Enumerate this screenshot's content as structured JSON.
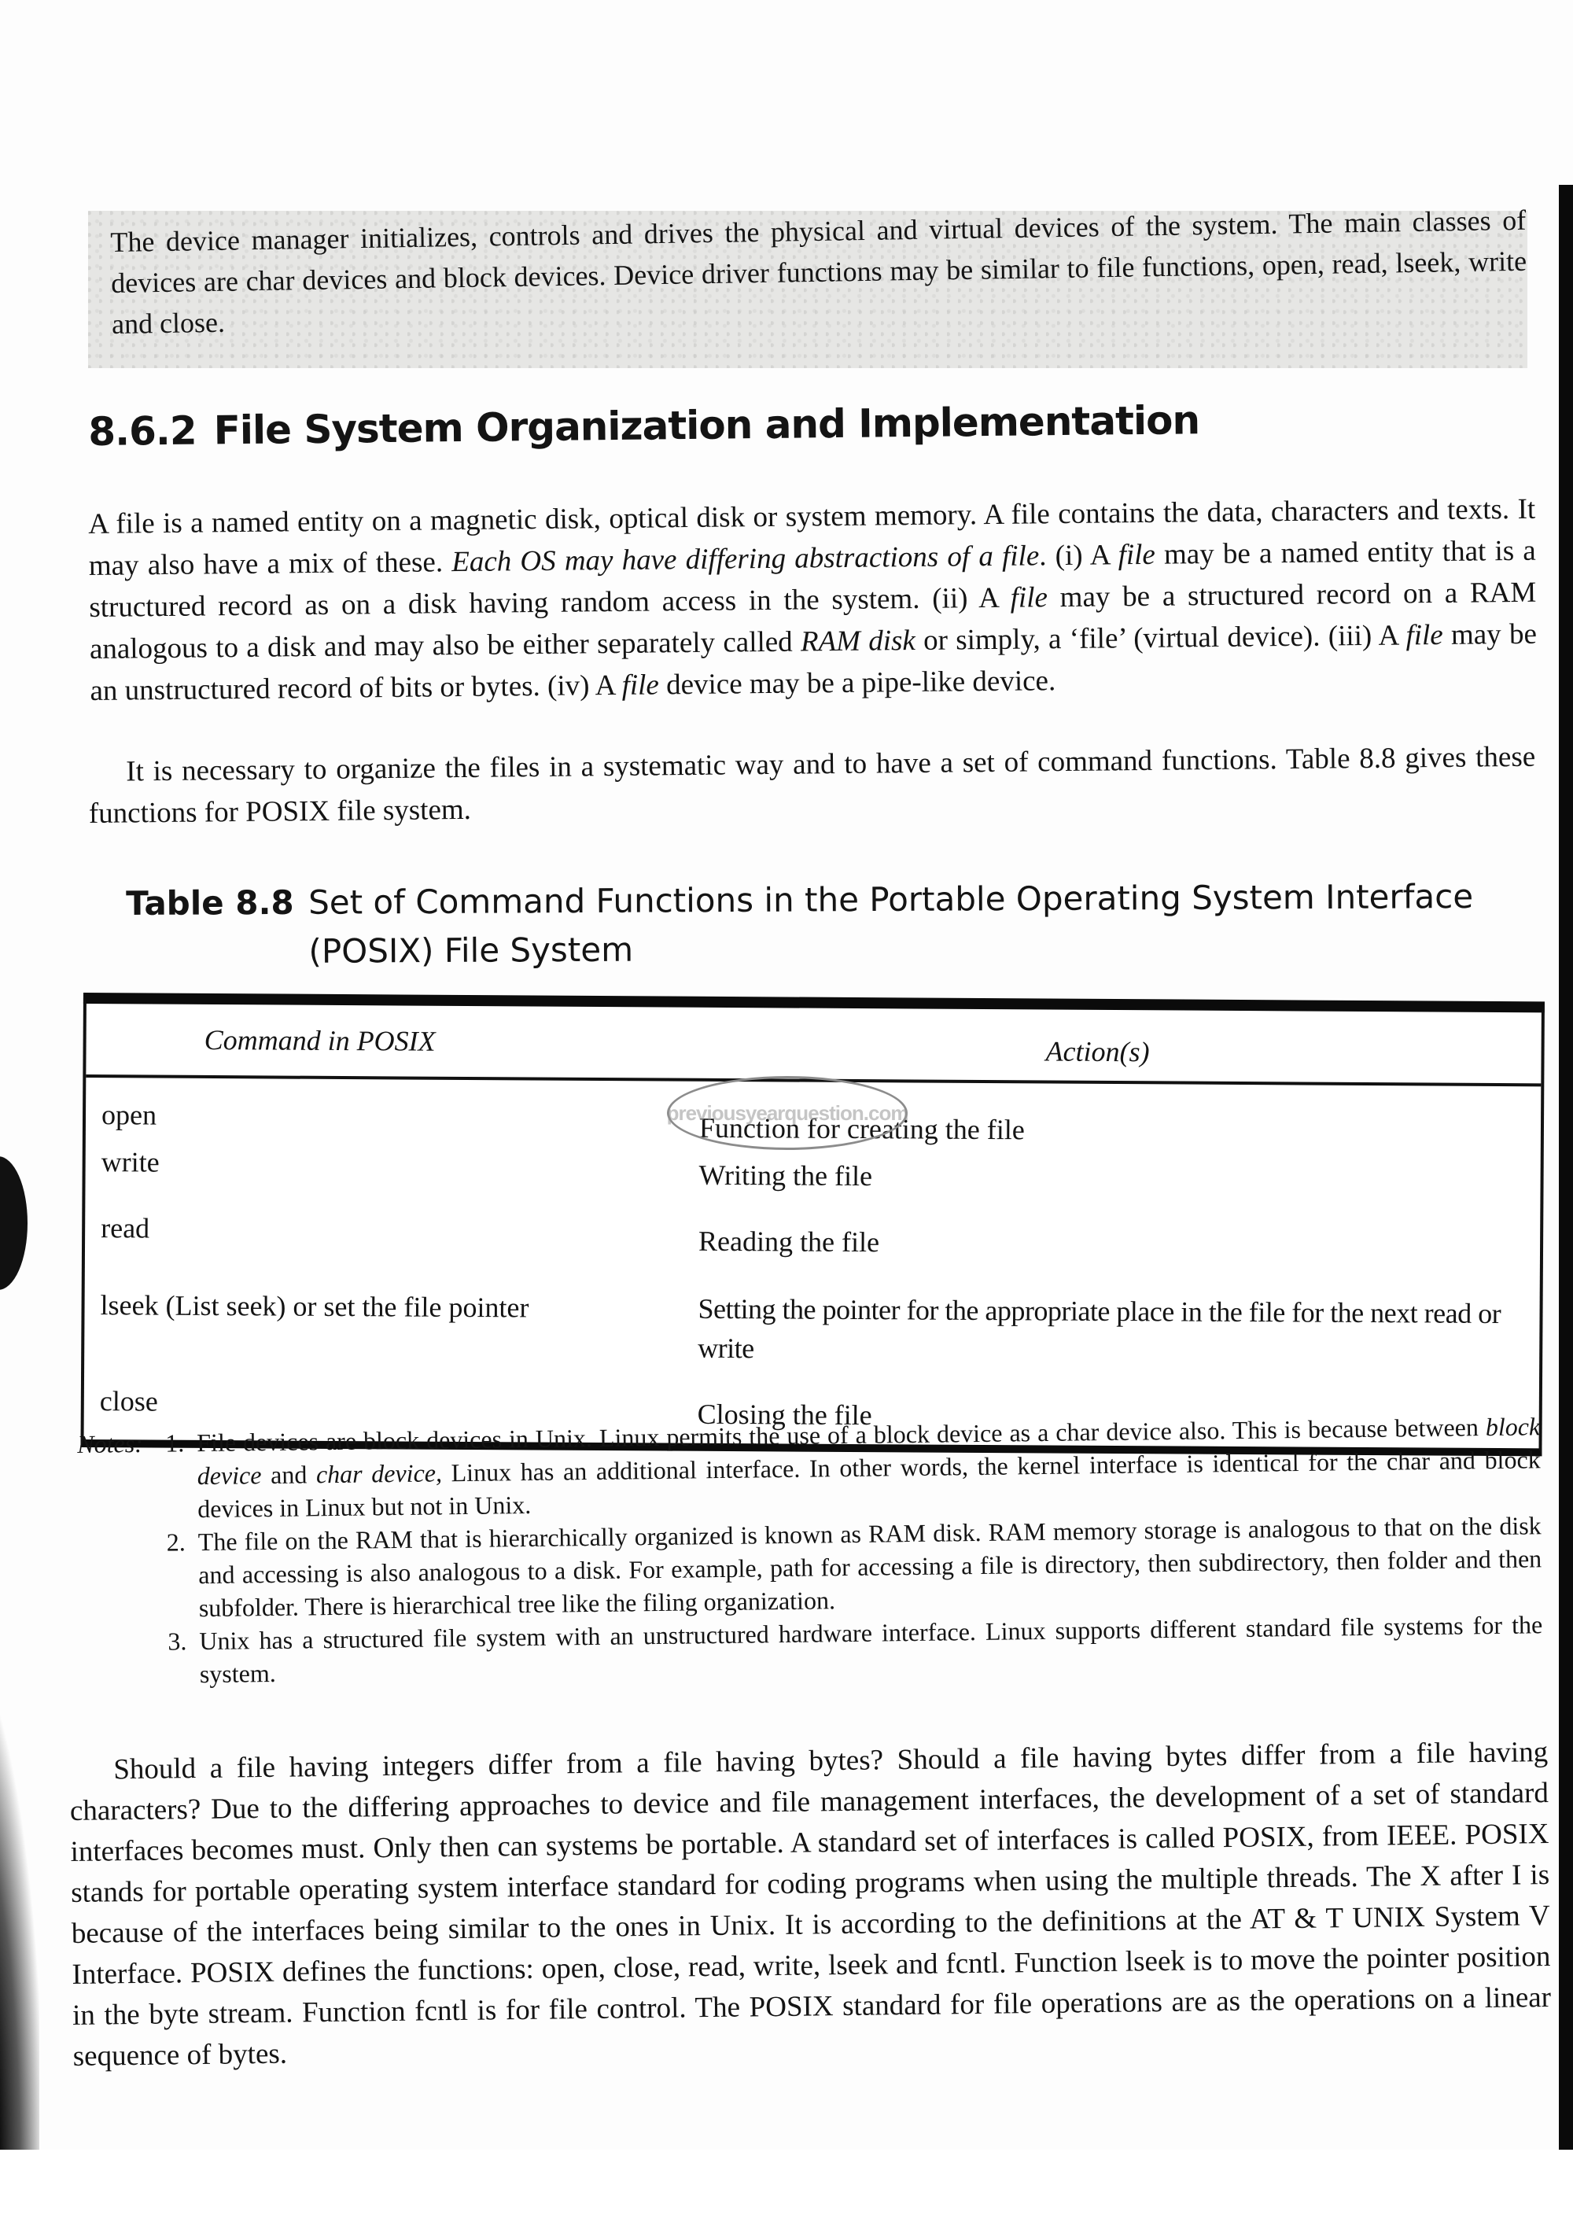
{
  "intro_box": {
    "text": "The device manager initializes, controls and drives the physical and virtual devices of the system. The main classes of devices are char devices and block devices. Device driver functions may be similar to file functions, open, read, lseek, write and close."
  },
  "section": {
    "number": "8.6.2",
    "title": "File System Organization and Implementation"
  },
  "paragraphs": [
    {
      "segments": [
        {
          "text": "A file is a named entity on a magnetic disk, optical disk or system memory. A file contains the data, characters and texts. It may also have a mix of these. ",
          "italic": false
        },
        {
          "text": "Each OS may have differing abstractions of a file",
          "italic": true
        },
        {
          "text": ". (i) A ",
          "italic": false
        },
        {
          "text": "file",
          "italic": true
        },
        {
          "text": " may be a named entity that is a structured record as on a disk having random access in the system. (ii) A ",
          "italic": false
        },
        {
          "text": "file",
          "italic": true
        },
        {
          "text": " may be a structured record on a RAM analogous to a disk and may also be either separately called ",
          "italic": false
        },
        {
          "text": "RAM disk",
          "italic": true
        },
        {
          "text": " or simply, a ‘file’ (virtual device). (iii) A ",
          "italic": false
        },
        {
          "text": "file",
          "italic": true
        },
        {
          "text": " may be an unstructured record of bits or bytes. (iv) A ",
          "italic": false
        },
        {
          "text": "file",
          "italic": true
        },
        {
          "text": " device may be a pipe-like device.",
          "italic": false
        }
      ]
    },
    {
      "segments": [
        {
          "text": "It is necessary to organize the files in a systematic way and to have a set of command functions. Table 8.8 gives these functions for POSIX file system.",
          "italic": false
        }
      ]
    }
  ],
  "table": {
    "label": "Table 8.8",
    "title": "Set of Command Functions in the Portable Operating System Interface (POSIX) File System",
    "headers": [
      "Command in POSIX",
      "Action(s)"
    ],
    "rows": [
      {
        "command": "open",
        "action": "Function for creating the file"
      },
      {
        "command": "write",
        "action": "Writing the file"
      },
      {
        "command": "read",
        "action": "Reading  the file"
      },
      {
        "command": "lseek (List seek) or set the file pointer",
        "action": "Setting the pointer for the appropriate place in the file for the next read or write"
      },
      {
        "command": "close",
        "action": "Closing the file"
      }
    ],
    "watermark": "previousyearquestion.com"
  },
  "notes": {
    "lead": "Notes:",
    "items": [
      {
        "index": "1.",
        "segments": [
          {
            "text": "File devices are block devices in Unix. Linux permits the use of a block device as a char device also. This is because between ",
            "italic": false
          },
          {
            "text": "block device",
            "italic": true
          },
          {
            "text": " and ",
            "italic": false
          },
          {
            "text": "char device,",
            "italic": true
          },
          {
            "text": " Linux has an additional interface. In other words, the kernel interface is identical for the char and block devices in Linux but not in Unix.",
            "italic": false
          }
        ]
      },
      {
        "index": "2.",
        "segments": [
          {
            "text": "The file on the RAM that is hierarchically organized is known as RAM disk. RAM memory storage is analogous to that on the disk and accessing is also analogous to a disk. For example, path for accessing a file is directory, then subdirectory, then folder and then subfolder. There is hierarchical tree like the filing organization.",
            "italic": false
          }
        ]
      },
      {
        "index": "3.",
        "segments": [
          {
            "text": "Unix has a structured file system with an unstructured hardware interface. Linux supports different standard file systems for the system.",
            "italic": false
          }
        ]
      }
    ]
  },
  "closing_paragraph": {
    "text": "Should a file having integers differ from a file having bytes? Should a file having bytes differ from a file having characters? Due to the differing approaches to device and file management interfaces, the development of a set of standard interfaces becomes must. Only then can systems be portable. A standard set of interfaces is called POSIX, from IEEE. POSIX stands for portable operating system interface standard for coding programs when using the multiple threads. The X after I is because of the interfaces being similar to the ones in Unix. It is according to the definitions at the AT & T UNIX System V Interface. POSIX defines the functions: open, close, read, write, lseek and fcntl. Function lseek is to move the pointer position in the byte stream. Function fcntl is for file control. The POSIX standard for file operations are as the operations on a linear sequence of bytes."
  },
  "colors": {
    "ink": "#141414",
    "intro_box_bg": "#e6e6e4",
    "page_bg": "#fdfdfd",
    "rule": "#0b0b0b"
  }
}
